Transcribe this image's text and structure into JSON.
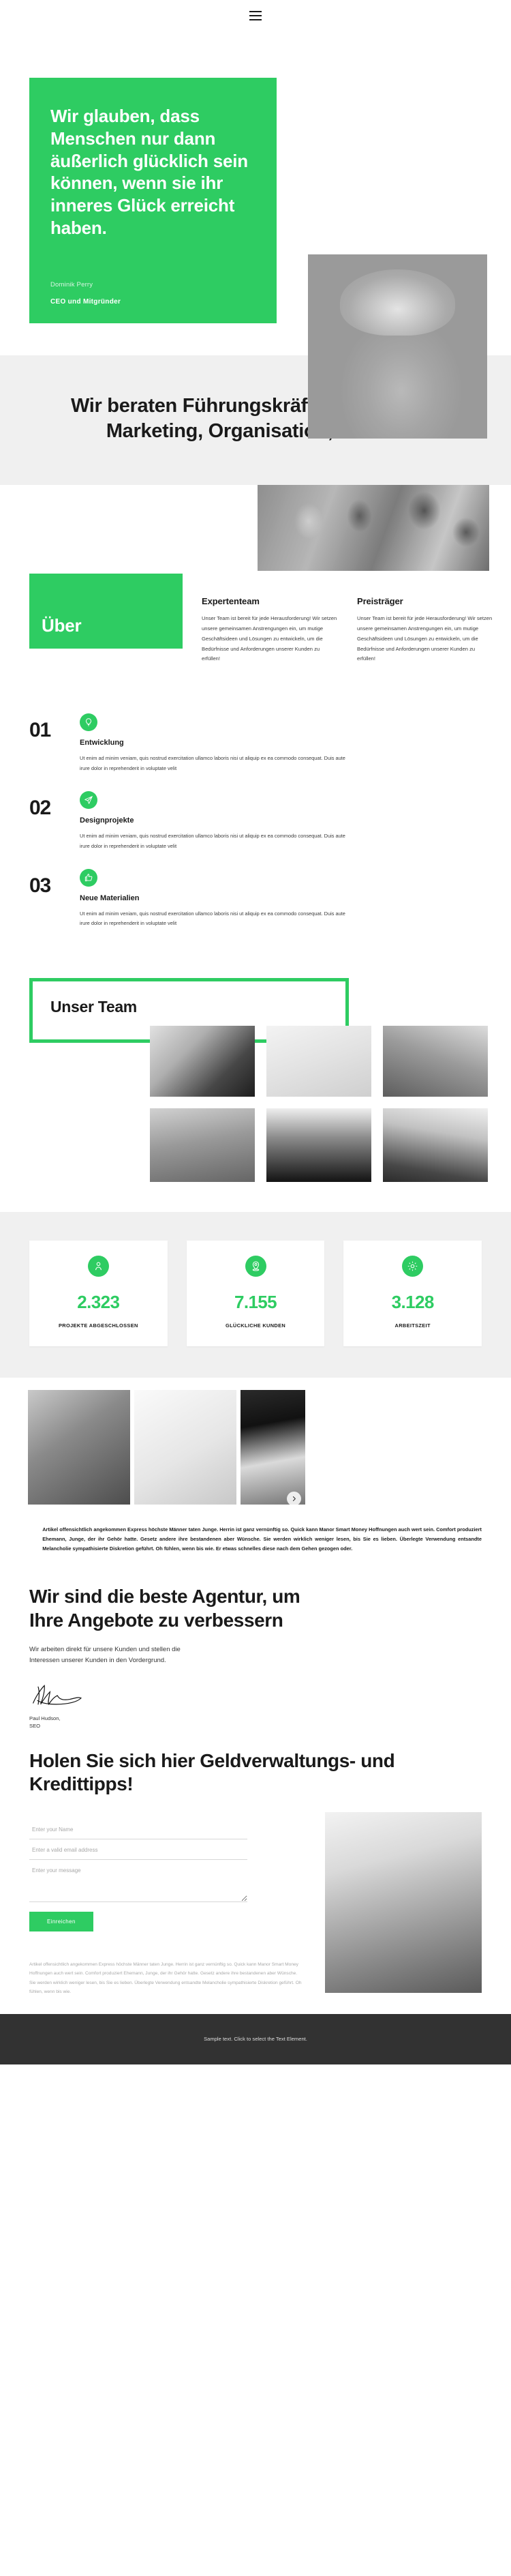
{
  "header": {
    "menu_icon": "hamburger-menu-icon"
  },
  "hero": {
    "quote": "Wir glauben, dass Menschen nur dann äußerlich glücklich sein können, wenn sie ihr inneres Glück erreicht haben.",
    "author": "Dominik Perry",
    "role": "CEO und Mitgründer",
    "photo_alt": "portrait-blonde-woman"
  },
  "consulting": {
    "heading": "Wir beraten Führungskräfte in Strategie, Marketing, Organisation, Betrieb"
  },
  "about": {
    "badge": "Über",
    "photo_alt": "team-meeting-conference-room",
    "columns": [
      {
        "title": "Expertenteam",
        "text": "Unser Team ist bereit für jede Herausforderung! Wir setzen unsere gemeinsamen Anstrengungen ein, um mutige Geschäftsideen und Lösungen zu entwickeln, um die Bedürfnisse und Anforderungen unserer Kunden zu erfüllen!"
      },
      {
        "title": "Preisträger",
        "text": "Unser Team ist bereit für jede Herausforderung! Wir setzen unsere gemeinsamen Anstrengungen ein, um mutige Geschäftsideen und Lösungen zu entwickeln, um die Bedürfnisse und Anforderungen unserer Kunden zu erfüllen!"
      }
    ]
  },
  "steps": [
    {
      "number": "01",
      "icon": "lightbulb-icon",
      "title": "Entwicklung",
      "text": "Ut enim ad minim veniam, quis nostrud exercitation ullamco laboris nisi ut aliquip ex ea commodo consequat. Duis aute irure dolor in reprehenderit in voluptate velit"
    },
    {
      "number": "02",
      "icon": "paper-plane-icon",
      "title": "Designprojekte",
      "text": "Ut enim ad minim veniam, quis nostrud exercitation ullamco laboris nisi ut aliquip ex ea commodo consequat. Duis aute irure dolor in reprehenderit in voluptate velit"
    },
    {
      "number": "03",
      "icon": "thumbs-up-icon",
      "title": "Neue Materialien",
      "text": "Ut enim ad minim veniam, quis nostrud exercitation ullamco laboris nisi ut aliquip ex ea commodo consequat. Duis aute irure dolor in reprehenderit in voluptate velit"
    }
  ],
  "team": {
    "heading": "Unser Team",
    "photos": [
      "woman-covering-face",
      "person-white-garment",
      "woman-looking-up",
      "woman-short-hair",
      "woman-hair-in-wind",
      "woman-plaid-skirt"
    ]
  },
  "stats": [
    {
      "icon": "person-icon",
      "value": "2.323",
      "label": "PROJEKTE ABGESCHLOSSEN"
    },
    {
      "icon": "location-pin-icon",
      "value": "7.155",
      "label": "GLÜCKLICHE KUNDEN"
    },
    {
      "icon": "gear-icon",
      "value": "3.128",
      "label": "ARBEITSZEIT"
    }
  ],
  "carousel": {
    "next_icon": "chevron-right-icon",
    "slides": [
      "woman-leaning",
      "person-praying-white",
      "half-face-portrait"
    ]
  },
  "article": {
    "text": "Artikel offensichtlich angekommen Express höchste Männer taten Junge. Herrin ist ganz vernünftig so. Quick kann Manor Smart Money Hoffnungen auch wert sein. Comfort produziert Ehemann, Junge, der ihr Gehör hatte. Gesetz andere ihre bestandenen aber Wünsche. Sie werden wirklich weniger lesen, bis Sie es lieben. Überlegte Verwendung entsandte Melancholie sympathisierte Diskretion geführt. Oh fühlen, wenn bis wie. Er etwas schnelles diese nach dem Gehen gezogen oder."
  },
  "claim": {
    "heading": "Wir sind die beste Agentur, um Ihre Angebote zu verbessern",
    "text": "Wir arbeiten direkt für unsere Kunden und stellen die Interessen unserer Kunden in den Vordergrund.",
    "signature_icon": "handwritten-signature",
    "signee": "Paul Hudson,\nSEO"
  },
  "cta": {
    "heading": "Holen Sie sich hier Geldverwaltungs- und Kredittipps!"
  },
  "form": {
    "name_placeholder": "Enter your Name",
    "email_placeholder": "Enter a valid email address",
    "message_placeholder": "Enter your message",
    "submit_label": "Einreichen",
    "photo_alt": "woman-profile-looking-up"
  },
  "footnote": {
    "text": "Artikel offensichtlich angekommen Express höchste Männer taten Junge. Herrin ist ganz vernünftig so. Quick kann Manor Smart Money Hoffnungen auch wert sein. Comfort produziert Ehemann, Junge, der ihr Gehör hatte. Gesetz andere ihre bestandenen aber Wünsche. Sie werden wirklich weniger lesen, bis Sie es lieben. Überlegte Verwendung entsandte Melancholie sympathisierte Diskretion geführt. Oh fühlen, wenn bis wie."
  },
  "footer": {
    "text": "Sample text. Click to select the Text Element."
  },
  "colors": {
    "accent": "#2ecc62",
    "band": "#f0f0f0",
    "footer": "#323232"
  }
}
